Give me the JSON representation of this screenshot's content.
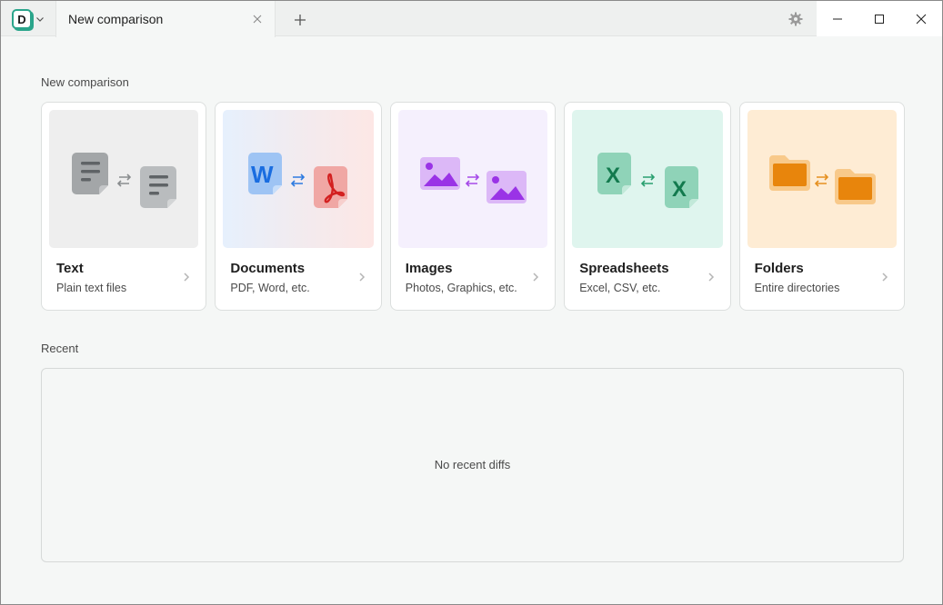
{
  "titlebar": {
    "app_logo_letter": "D",
    "tab_title": "New comparison"
  },
  "colors": {
    "accent": "#2aa58b",
    "text_thumb_bg": "#eeeeee",
    "images_thumb_bg": "#f5f0fd",
    "spreadsheets_thumb_bg": "#dff5ee",
    "folders_thumb_bg": "#feecd4",
    "documents_thumb_bg_start": "#e6f0fd",
    "documents_thumb_bg_end": "#fde7e5"
  },
  "new_comparison": {
    "heading": "New comparison",
    "cards": [
      {
        "title": "Text",
        "subtitle": "Plain text files",
        "icon": "text-file-icon"
      },
      {
        "title": "Documents",
        "subtitle": "PDF, Word, etc.",
        "icon": "word-pdf-icon"
      },
      {
        "title": "Images",
        "subtitle": "Photos, Graphics, etc.",
        "icon": "image-icon"
      },
      {
        "title": "Spreadsheets",
        "subtitle": "Excel, CSV, etc.",
        "icon": "excel-icon"
      },
      {
        "title": "Folders",
        "subtitle": "Entire directories",
        "icon": "folder-icon"
      }
    ]
  },
  "recent": {
    "heading": "Recent",
    "empty_message": "No recent diffs"
  }
}
